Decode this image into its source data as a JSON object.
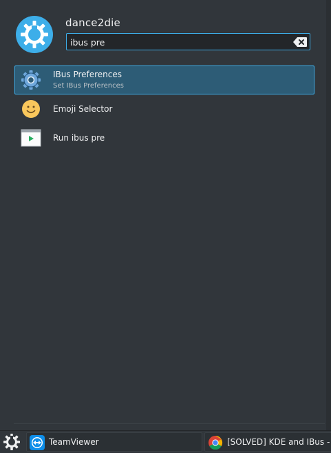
{
  "user": {
    "name": "dance2die"
  },
  "search": {
    "value": "ibus pre",
    "placeholder": ""
  },
  "results": [
    {
      "title": "IBus Preferences",
      "subtitle": "Set IBus Preferences",
      "icon": "gear-icon",
      "selected": true
    },
    {
      "title": "Emoji Selector",
      "subtitle": "",
      "icon": "emoji-icon",
      "selected": false
    },
    {
      "title": "Run ibus pre",
      "subtitle": "",
      "icon": "run-command-icon",
      "selected": false
    }
  ],
  "taskbar": {
    "tasks": [
      {
        "label": "TeamViewer",
        "icon": "teamviewer-icon"
      },
      {
        "label": "[SOLVED] KDE and IBus -",
        "icon": "chrome-icon"
      }
    ]
  },
  "colors": {
    "accent": "#3daee9",
    "selected_bg": "#2d5c76",
    "panel_bg": "#31363b"
  }
}
